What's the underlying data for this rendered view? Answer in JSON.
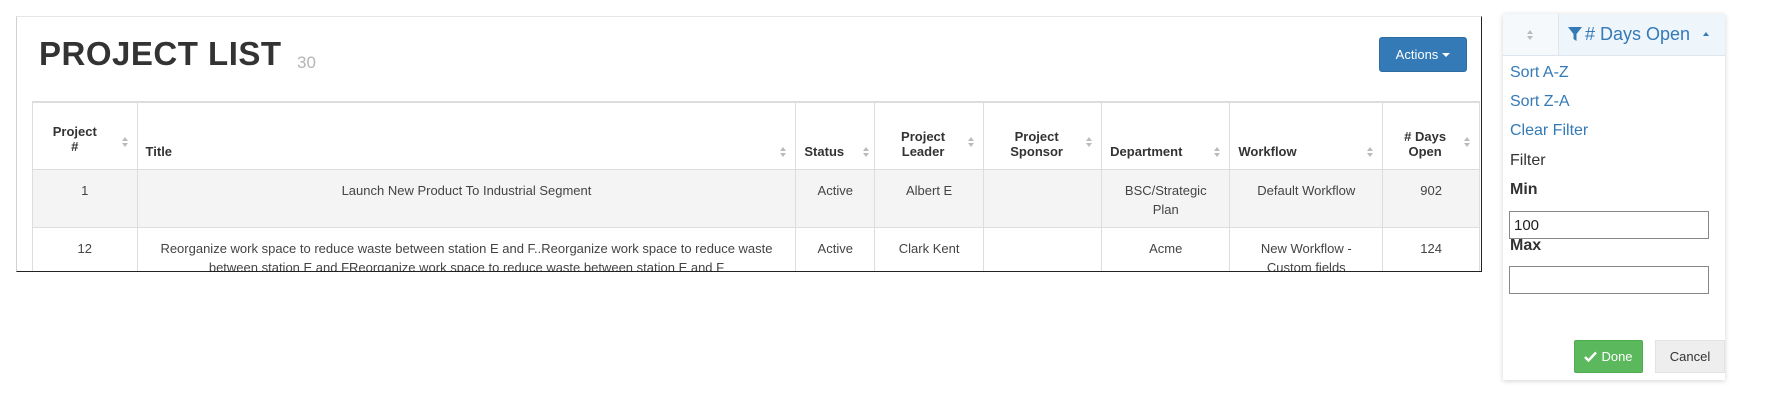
{
  "header": {
    "title": "PROJECT LIST",
    "count": "30",
    "actions_label": "Actions"
  },
  "table": {
    "columns": [
      "Project #",
      "Title",
      "Status",
      "Project Leader",
      "Project Sponsor",
      "Department",
      "Workflow",
      "# Days Open"
    ],
    "rows": [
      {
        "project_no": "1",
        "title": "Launch New Product To Industrial Segment",
        "status": "Active",
        "leader": "Albert E",
        "sponsor": "",
        "department": "BSC/Strategic Plan",
        "workflow": "Default Workflow",
        "days_open": "902"
      },
      {
        "project_no": "12",
        "title": "Reorganize work space to reduce waste between station E and F..Reorganize work space to reduce waste between station E and FReorganize work space to reduce waste between station E and F",
        "status": "Active",
        "leader": "Clark Kent",
        "sponsor": "",
        "department": "Acme",
        "workflow": "New Workflow - Custom fields",
        "days_open": "124"
      }
    ]
  },
  "filter_popup": {
    "column_title": "# Days Open",
    "sort_az": "Sort A-Z",
    "sort_za": "Sort Z-A",
    "clear_filter": "Clear Filter",
    "filter_label": "Filter",
    "min_label": "Min",
    "min_value": "100",
    "max_label": "Max",
    "max_value": "",
    "done_label": "Done",
    "cancel_label": "Cancel"
  },
  "colors": {
    "primary": "#337ab7",
    "success": "#5cb85c",
    "row_alt": "#f4f4f4"
  },
  "icons": [
    "sort-icon",
    "filter-funnel-icon",
    "caret-up-icon",
    "caret-down-icon",
    "check-icon"
  ]
}
